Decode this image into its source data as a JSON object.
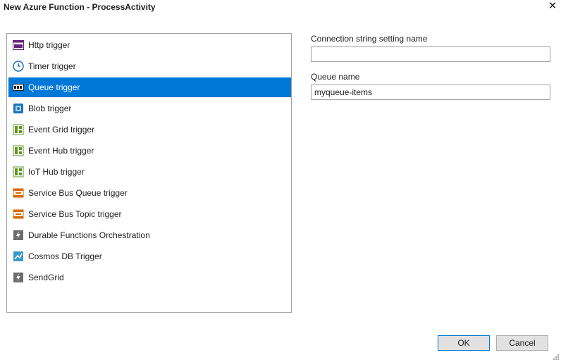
{
  "window": {
    "title": "New Azure Function - ProcessActivity",
    "close_glyph": "✕"
  },
  "triggers": [
    {
      "label": "Http trigger",
      "icon": "http-icon",
      "selected": false
    },
    {
      "label": "Timer trigger",
      "icon": "clock-icon",
      "selected": false
    },
    {
      "label": "Queue trigger",
      "icon": "queue-icon",
      "selected": true
    },
    {
      "label": "Blob trigger",
      "icon": "blob-icon",
      "selected": false
    },
    {
      "label": "Event Grid trigger",
      "icon": "event-grid-icon",
      "selected": false
    },
    {
      "label": "Event Hub trigger",
      "icon": "event-hub-icon",
      "selected": false
    },
    {
      "label": "IoT Hub trigger",
      "icon": "iot-hub-icon",
      "selected": false
    },
    {
      "label": "Service Bus Queue trigger",
      "icon": "service-bus-queue-icon",
      "selected": false
    },
    {
      "label": "Service Bus Topic trigger",
      "icon": "service-bus-topic-icon",
      "selected": false
    },
    {
      "label": "Durable Functions Orchestration",
      "icon": "function-icon",
      "selected": false
    },
    {
      "label": "Cosmos DB Trigger",
      "icon": "cosmos-db-icon",
      "selected": false
    },
    {
      "label": "SendGrid",
      "icon": "sendgrid-icon",
      "selected": false
    }
  ],
  "settings": {
    "connection_label": "Connection string setting name",
    "connection_value": "",
    "queue_label": "Queue name",
    "queue_value": "myqueue-items"
  },
  "buttons": {
    "ok": "OK",
    "cancel": "Cancel"
  },
  "colors": {
    "selection": "#0078d7",
    "accent_border": "#0078d7"
  }
}
